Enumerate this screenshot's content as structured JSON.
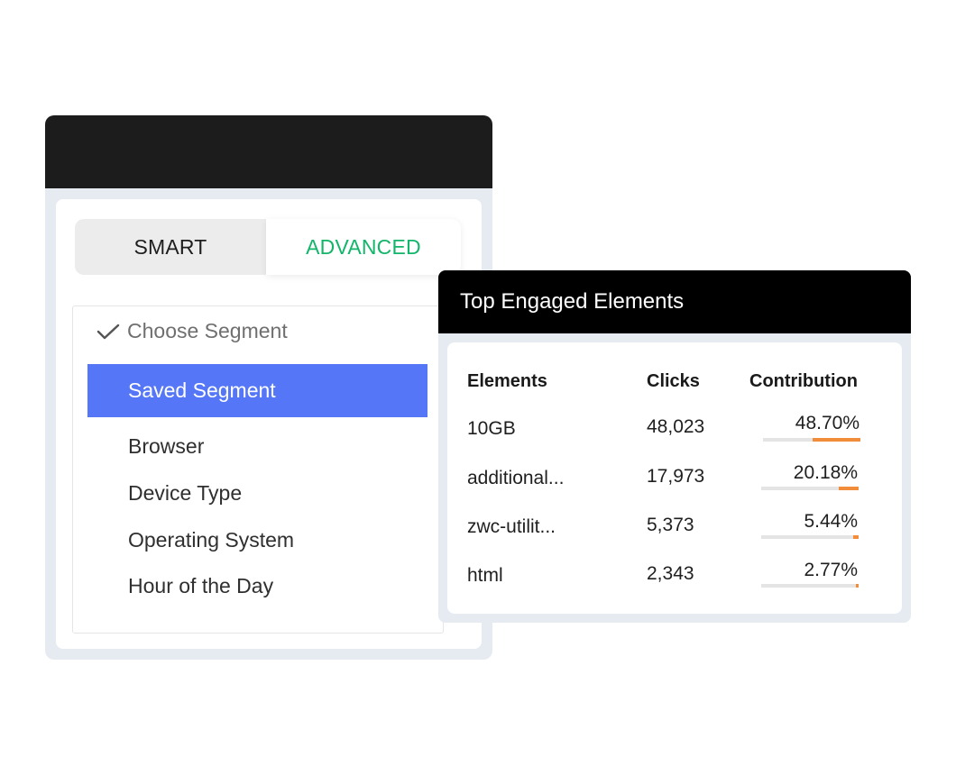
{
  "segment_panel": {
    "tabs": {
      "smart": "SMART",
      "advanced": "ADVANCED",
      "active": "ADVANCED"
    },
    "choose_label": "Choose Segment",
    "selected": "Saved Segment",
    "items": [
      "Browser",
      "Device Type",
      "Operating System",
      "Hour of the Day"
    ]
  },
  "engaged_panel": {
    "title": "Top Engaged Elements",
    "columns": {
      "elements": "Elements",
      "clicks": "Clicks",
      "contribution": "Contribution"
    },
    "rows": [
      {
        "element": "10GB",
        "clicks": "48,023",
        "contribution": "48.70%",
        "share": 0.487
      },
      {
        "element": "additional...",
        "clicks": "17,973",
        "contribution": "20.18%",
        "share": 0.2018
      },
      {
        "element": "zwc-utilit...",
        "clicks": "5,373",
        "contribution": "5.44%",
        "share": 0.0544
      },
      {
        "element": "html",
        "clicks": "2,343",
        "contribution": "2.77%",
        "share": 0.0277
      }
    ]
  },
  "colors": {
    "accent_green": "#12b56a",
    "selected_blue": "#5577f7",
    "bar_orange": "#f08c3a",
    "header_dark": "#1c1c1c"
  }
}
